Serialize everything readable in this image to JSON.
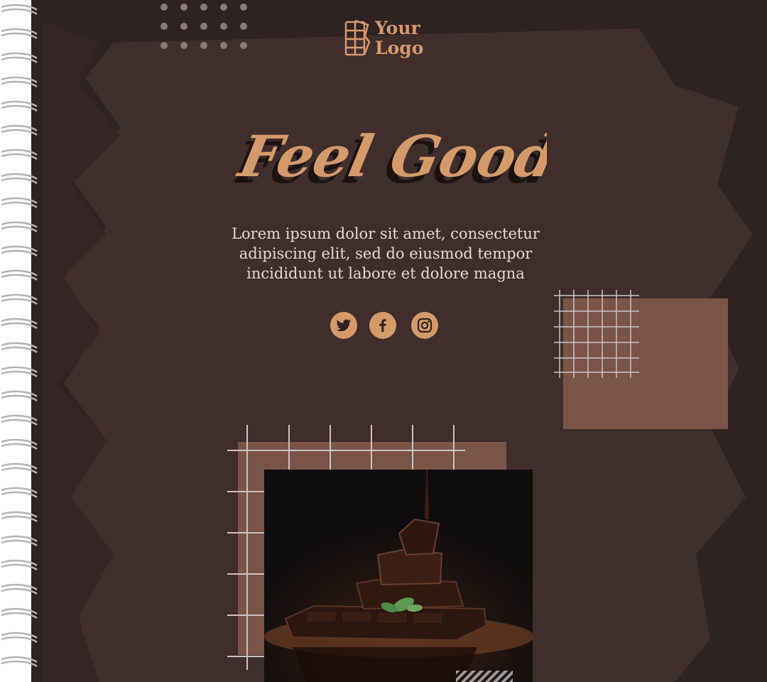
{
  "brand": {
    "logo_line1": "Your",
    "logo_line2": "Logo",
    "icon": "chocolate-bar-icon"
  },
  "headline": "Feel Good",
  "body": {
    "line1": "Lorem ipsum dolor sit amet, consectetur",
    "line2": "adipiscing elit, sed do eiusmod tempor",
    "line3": "incididunt ut labore et dolore magna"
  },
  "social": [
    {
      "name": "twitter",
      "icon": "twitter-icon"
    },
    {
      "name": "facebook",
      "icon": "facebook-icon"
    },
    {
      "name": "instagram",
      "icon": "instagram-icon"
    }
  ],
  "image": {
    "subject": "chocolate-photo"
  },
  "colors": {
    "background": "#2e2222",
    "brush": "#3f2e2c",
    "accent": "#d59a6a",
    "square": "#7a5446",
    "text": "#e3d8d4"
  }
}
